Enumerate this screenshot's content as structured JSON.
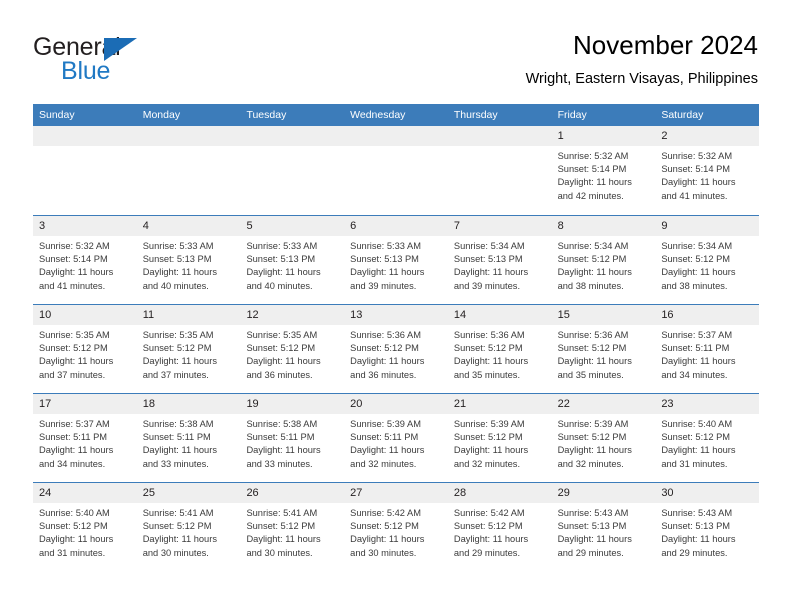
{
  "brand": {
    "word1": "General",
    "word2": "Blue",
    "accent_color": "#2079c4"
  },
  "header": {
    "title": "November 2024",
    "subtitle": "Wright, Eastern Visayas, Philippines"
  },
  "theme": {
    "header_blue": "#3c7cba",
    "day_band_gray": "#efefef",
    "text_gray": "#3b3b3b"
  },
  "weekdays": [
    "Sunday",
    "Monday",
    "Tuesday",
    "Wednesday",
    "Thursday",
    "Friday",
    "Saturday"
  ],
  "weeks": [
    [
      {
        "day": "",
        "lines": []
      },
      {
        "day": "",
        "lines": []
      },
      {
        "day": "",
        "lines": []
      },
      {
        "day": "",
        "lines": []
      },
      {
        "day": "",
        "lines": []
      },
      {
        "day": "1",
        "lines": [
          "Sunrise: 5:32 AM",
          "Sunset: 5:14 PM",
          "Daylight: 11 hours",
          "and 42 minutes."
        ]
      },
      {
        "day": "2",
        "lines": [
          "Sunrise: 5:32 AM",
          "Sunset: 5:14 PM",
          "Daylight: 11 hours",
          "and 41 minutes."
        ]
      }
    ],
    [
      {
        "day": "3",
        "lines": [
          "Sunrise: 5:32 AM",
          "Sunset: 5:14 PM",
          "Daylight: 11 hours",
          "and 41 minutes."
        ]
      },
      {
        "day": "4",
        "lines": [
          "Sunrise: 5:33 AM",
          "Sunset: 5:13 PM",
          "Daylight: 11 hours",
          "and 40 minutes."
        ]
      },
      {
        "day": "5",
        "lines": [
          "Sunrise: 5:33 AM",
          "Sunset: 5:13 PM",
          "Daylight: 11 hours",
          "and 40 minutes."
        ]
      },
      {
        "day": "6",
        "lines": [
          "Sunrise: 5:33 AM",
          "Sunset: 5:13 PM",
          "Daylight: 11 hours",
          "and 39 minutes."
        ]
      },
      {
        "day": "7",
        "lines": [
          "Sunrise: 5:34 AM",
          "Sunset: 5:13 PM",
          "Daylight: 11 hours",
          "and 39 minutes."
        ]
      },
      {
        "day": "8",
        "lines": [
          "Sunrise: 5:34 AM",
          "Sunset: 5:12 PM",
          "Daylight: 11 hours",
          "and 38 minutes."
        ]
      },
      {
        "day": "9",
        "lines": [
          "Sunrise: 5:34 AM",
          "Sunset: 5:12 PM",
          "Daylight: 11 hours",
          "and 38 minutes."
        ]
      }
    ],
    [
      {
        "day": "10",
        "lines": [
          "Sunrise: 5:35 AM",
          "Sunset: 5:12 PM",
          "Daylight: 11 hours",
          "and 37 minutes."
        ]
      },
      {
        "day": "11",
        "lines": [
          "Sunrise: 5:35 AM",
          "Sunset: 5:12 PM",
          "Daylight: 11 hours",
          "and 37 minutes."
        ]
      },
      {
        "day": "12",
        "lines": [
          "Sunrise: 5:35 AM",
          "Sunset: 5:12 PM",
          "Daylight: 11 hours",
          "and 36 minutes."
        ]
      },
      {
        "day": "13",
        "lines": [
          "Sunrise: 5:36 AM",
          "Sunset: 5:12 PM",
          "Daylight: 11 hours",
          "and 36 minutes."
        ]
      },
      {
        "day": "14",
        "lines": [
          "Sunrise: 5:36 AM",
          "Sunset: 5:12 PM",
          "Daylight: 11 hours",
          "and 35 minutes."
        ]
      },
      {
        "day": "15",
        "lines": [
          "Sunrise: 5:36 AM",
          "Sunset: 5:12 PM",
          "Daylight: 11 hours",
          "and 35 minutes."
        ]
      },
      {
        "day": "16",
        "lines": [
          "Sunrise: 5:37 AM",
          "Sunset: 5:11 PM",
          "Daylight: 11 hours",
          "and 34 minutes."
        ]
      }
    ],
    [
      {
        "day": "17",
        "lines": [
          "Sunrise: 5:37 AM",
          "Sunset: 5:11 PM",
          "Daylight: 11 hours",
          "and 34 minutes."
        ]
      },
      {
        "day": "18",
        "lines": [
          "Sunrise: 5:38 AM",
          "Sunset: 5:11 PM",
          "Daylight: 11 hours",
          "and 33 minutes."
        ]
      },
      {
        "day": "19",
        "lines": [
          "Sunrise: 5:38 AM",
          "Sunset: 5:11 PM",
          "Daylight: 11 hours",
          "and 33 minutes."
        ]
      },
      {
        "day": "20",
        "lines": [
          "Sunrise: 5:39 AM",
          "Sunset: 5:11 PM",
          "Daylight: 11 hours",
          "and 32 minutes."
        ]
      },
      {
        "day": "21",
        "lines": [
          "Sunrise: 5:39 AM",
          "Sunset: 5:12 PM",
          "Daylight: 11 hours",
          "and 32 minutes."
        ]
      },
      {
        "day": "22",
        "lines": [
          "Sunrise: 5:39 AM",
          "Sunset: 5:12 PM",
          "Daylight: 11 hours",
          "and 32 minutes."
        ]
      },
      {
        "day": "23",
        "lines": [
          "Sunrise: 5:40 AM",
          "Sunset: 5:12 PM",
          "Daylight: 11 hours",
          "and 31 minutes."
        ]
      }
    ],
    [
      {
        "day": "24",
        "lines": [
          "Sunrise: 5:40 AM",
          "Sunset: 5:12 PM",
          "Daylight: 11 hours",
          "and 31 minutes."
        ]
      },
      {
        "day": "25",
        "lines": [
          "Sunrise: 5:41 AM",
          "Sunset: 5:12 PM",
          "Daylight: 11 hours",
          "and 30 minutes."
        ]
      },
      {
        "day": "26",
        "lines": [
          "Sunrise: 5:41 AM",
          "Sunset: 5:12 PM",
          "Daylight: 11 hours",
          "and 30 minutes."
        ]
      },
      {
        "day": "27",
        "lines": [
          "Sunrise: 5:42 AM",
          "Sunset: 5:12 PM",
          "Daylight: 11 hours",
          "and 30 minutes."
        ]
      },
      {
        "day": "28",
        "lines": [
          "Sunrise: 5:42 AM",
          "Sunset: 5:12 PM",
          "Daylight: 11 hours",
          "and 29 minutes."
        ]
      },
      {
        "day": "29",
        "lines": [
          "Sunrise: 5:43 AM",
          "Sunset: 5:13 PM",
          "Daylight: 11 hours",
          "and 29 minutes."
        ]
      },
      {
        "day": "30",
        "lines": [
          "Sunrise: 5:43 AM",
          "Sunset: 5:13 PM",
          "Daylight: 11 hours",
          "and 29 minutes."
        ]
      }
    ]
  ]
}
